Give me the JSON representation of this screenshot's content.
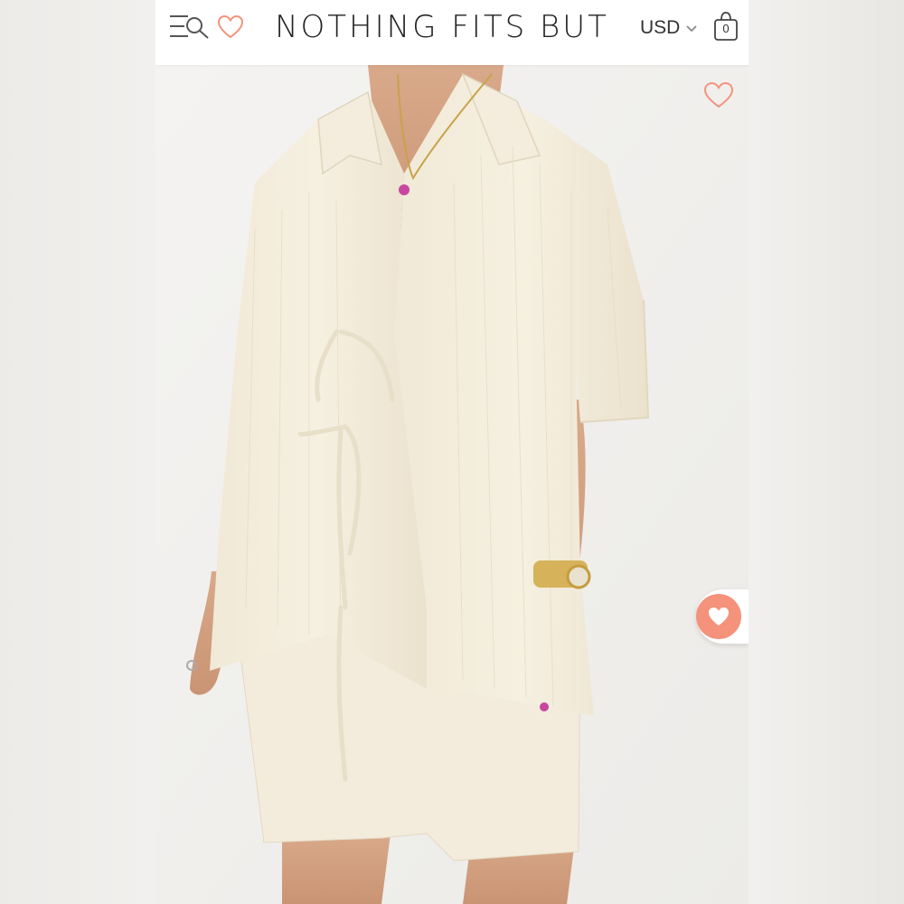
{
  "header": {
    "brand": "NOTHING FITS BUT",
    "currency": "USD",
    "cart_count": "0",
    "icons": {
      "menu": "menu-search-icon",
      "wishlist": "heart-outline-icon",
      "currency_toggle": "chevron-down-icon",
      "cart": "shopping-bag-icon"
    }
  },
  "product": {
    "image_icon": "heart-outline-icon",
    "floating_icon": "heart-filled-icon"
  },
  "colors": {
    "accent": "#f4927c",
    "header_bg": "#ffffff",
    "page_bg": "#f3f2f0",
    "text": "#222222"
  }
}
